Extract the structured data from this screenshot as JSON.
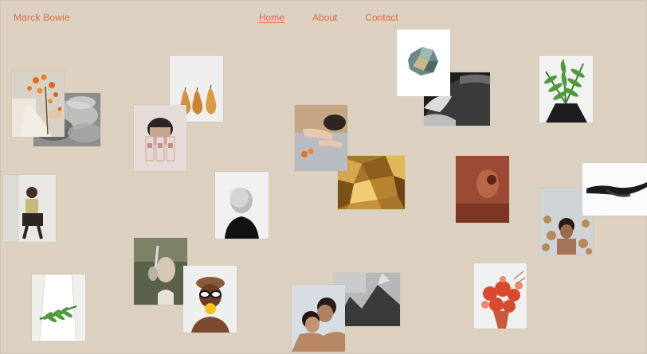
{
  "site": {
    "brand": "Marck Bowie"
  },
  "nav": {
    "items": [
      {
        "label": "Home",
        "active": true
      },
      {
        "label": "About",
        "active": false
      },
      {
        "label": "Contact",
        "active": false
      }
    ]
  },
  "colors": {
    "background": "#dcd0c0",
    "accent": "#e06b45"
  },
  "gallery": {
    "images": [
      "orange-flowers-hands",
      "grey-clouds",
      "three-pears",
      "woman-with-glass-boxes",
      "woman-with-oranges-on-bed",
      "green-stone",
      "ocean-wave",
      "fern-leaves-person",
      "woman-sitting-chair",
      "blurred-portrait",
      "gold-foil",
      "red-figure",
      "reclining-figure-bw",
      "woman-dried-flowers",
      "woman-with-mirror",
      "person-with-sunglasses-flowers",
      "person-white-coat-fern",
      "couple-embrace",
      "bw-landscape",
      "red-flower-bouquet"
    ]
  }
}
